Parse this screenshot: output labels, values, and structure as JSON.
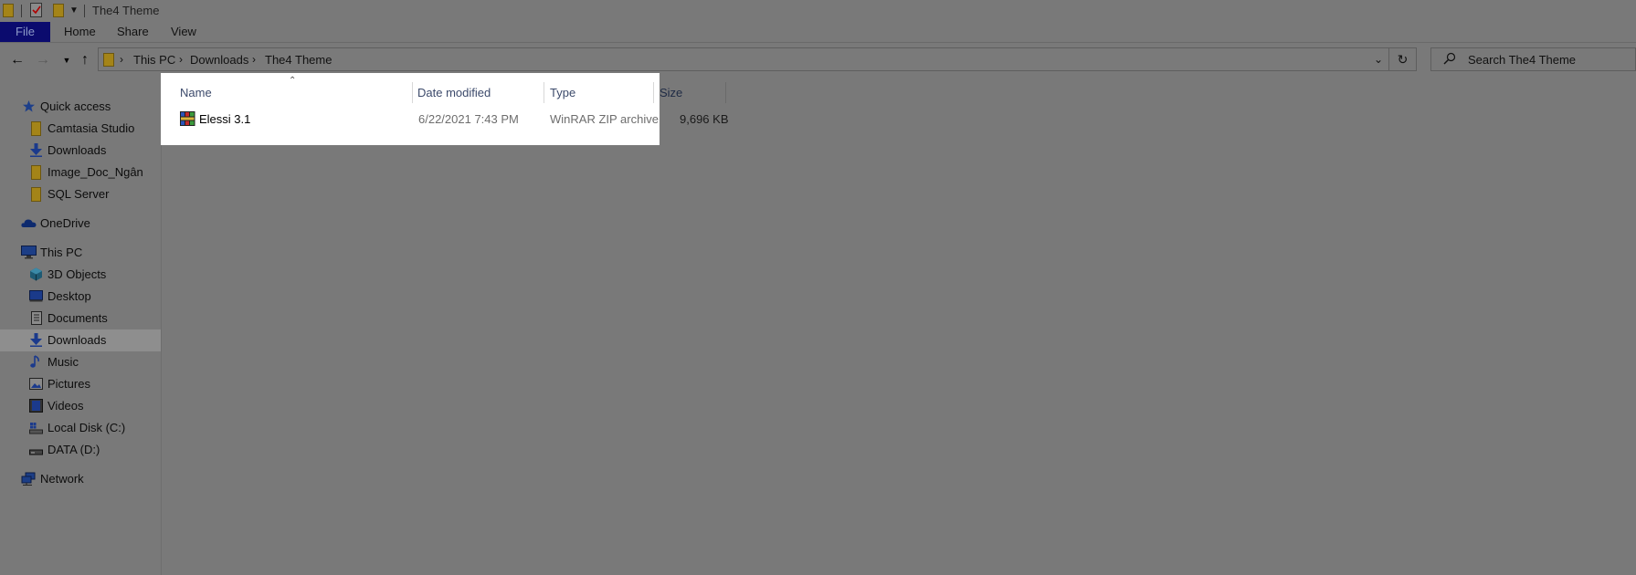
{
  "window": {
    "title": "The4 Theme"
  },
  "ribbon": {
    "tabs": [
      "File",
      "Home",
      "Share",
      "View"
    ]
  },
  "address": {
    "breadcrumb": [
      "This PC",
      "Downloads",
      "The4 Theme"
    ],
    "search_placeholder": "Search The4 Theme"
  },
  "sidebar": {
    "quick_access": {
      "label": "Quick access",
      "items": [
        {
          "label": "Camtasia Studio",
          "icon": "folder-icon"
        },
        {
          "label": "Downloads",
          "icon": "download-icon"
        },
        {
          "label": "Image_Doc_Ngân",
          "icon": "folder-icon"
        },
        {
          "label": "SQL Server",
          "icon": "folder-icon"
        }
      ]
    },
    "onedrive": {
      "label": "OneDrive"
    },
    "this_pc": {
      "label": "This PC",
      "items": [
        {
          "label": "3D Objects",
          "icon": "cube-icon"
        },
        {
          "label": "Desktop",
          "icon": "desktop-icon"
        },
        {
          "label": "Documents",
          "icon": "documents-icon"
        },
        {
          "label": "Downloads",
          "icon": "download-icon",
          "selected": true
        },
        {
          "label": "Music",
          "icon": "music-icon"
        },
        {
          "label": "Pictures",
          "icon": "pictures-icon"
        },
        {
          "label": "Videos",
          "icon": "videos-icon"
        },
        {
          "label": "Local Disk (C:)",
          "icon": "disk-icon"
        },
        {
          "label": "DATA (D:)",
          "icon": "drive-icon"
        }
      ]
    },
    "network": {
      "label": "Network"
    }
  },
  "columns": {
    "name": "Name",
    "date": "Date modified",
    "type": "Type",
    "size": "Size"
  },
  "files": [
    {
      "name": "Elessi 3.1",
      "date": "6/22/2021 7:43 PM",
      "type": "WinRAR ZIP archive",
      "size": "9,696 KB",
      "icon": "winrar-archive-icon"
    }
  ],
  "colors": {
    "background": "#797979",
    "file_tab": "#0b0b6e",
    "selected": "#8e8e8e",
    "highlight": "#ffffff"
  }
}
